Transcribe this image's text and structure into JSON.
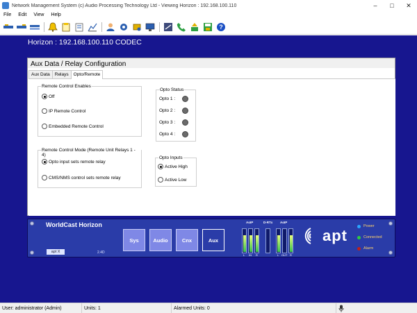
{
  "window": {
    "title": "Network Management System (c) Audio Processing Technology Ltd - Viewing Horizon : 192.168.100.110",
    "controls": [
      "minimize-icon",
      "maximize-icon",
      "close-icon"
    ]
  },
  "menu": {
    "items": [
      "File",
      "Edit",
      "View",
      "Help"
    ]
  },
  "toolbar": {
    "icons": [
      "network-view-icon",
      "codec-view-icon",
      "device-list-icon",
      "alarm-bell-icon",
      "log-icon",
      "report-icon",
      "user-icon",
      "settings-gear-icon",
      "configure-icon",
      "monitor-icon",
      "transfer-icon",
      "phone-icon",
      "upload-icon",
      "save-icon",
      "help-icon"
    ]
  },
  "workspace": {
    "header": "Horizon : 192.168.100.110 CODEC"
  },
  "panel": {
    "title": "Aux Data / Relay Configuration",
    "tabs": [
      "Aux Data",
      "Relays",
      "Opto/Remote"
    ],
    "active_tab": "Opto/Remote",
    "remote_control_enables": {
      "legend": "Remote Control Enables",
      "options": [
        "Off",
        "IP Remote Control",
        "Embedded Remote Control"
      ],
      "selected": "Off"
    },
    "remote_control_mode": {
      "legend": "Remote Control Mode (Remote Unit Relays 1 - 4)",
      "options": [
        "Opto input sets remote relay",
        "CMS/NMS control sets remote relay"
      ],
      "selected": "Opto input sets remote relay"
    },
    "opto_status": {
      "legend": "Opto Status",
      "items": [
        "Opto 1 :",
        "Opto 2 :",
        "Opto 3 :",
        "Opto 4 :"
      ],
      "led_color": "#6b6b6b"
    },
    "opto_inputs": {
      "legend": "Opto Inputs",
      "options": [
        "Active High",
        "Active Low"
      ],
      "selected": "Active High"
    }
  },
  "device": {
    "name": "WorldCast Horizon",
    "version": "2.4D",
    "badge": "apt X",
    "buttons": [
      "Sys",
      "Audio",
      "Cnx",
      "Aux"
    ],
    "active_button": "Aux",
    "meters": [
      {
        "title": "AoIP",
        "labels": [
          "L",
          "IN",
          "R"
        ]
      },
      {
        "title": "D-RTx",
        "labels": []
      },
      {
        "title": "AoIP",
        "labels": [
          "L",
          "OUT",
          "R"
        ]
      }
    ],
    "logo": "apt",
    "status": [
      {
        "label": "Power",
        "color": "#2aa6ff"
      },
      {
        "label": "Connected",
        "color": "#2ecc40"
      },
      {
        "label": "Alarm",
        "color": "#c0201a"
      }
    ]
  },
  "statusbar": {
    "user": "User: administrator (Admin)",
    "units": "Units: 1",
    "alarmed": "Alarmed Units: 0"
  }
}
